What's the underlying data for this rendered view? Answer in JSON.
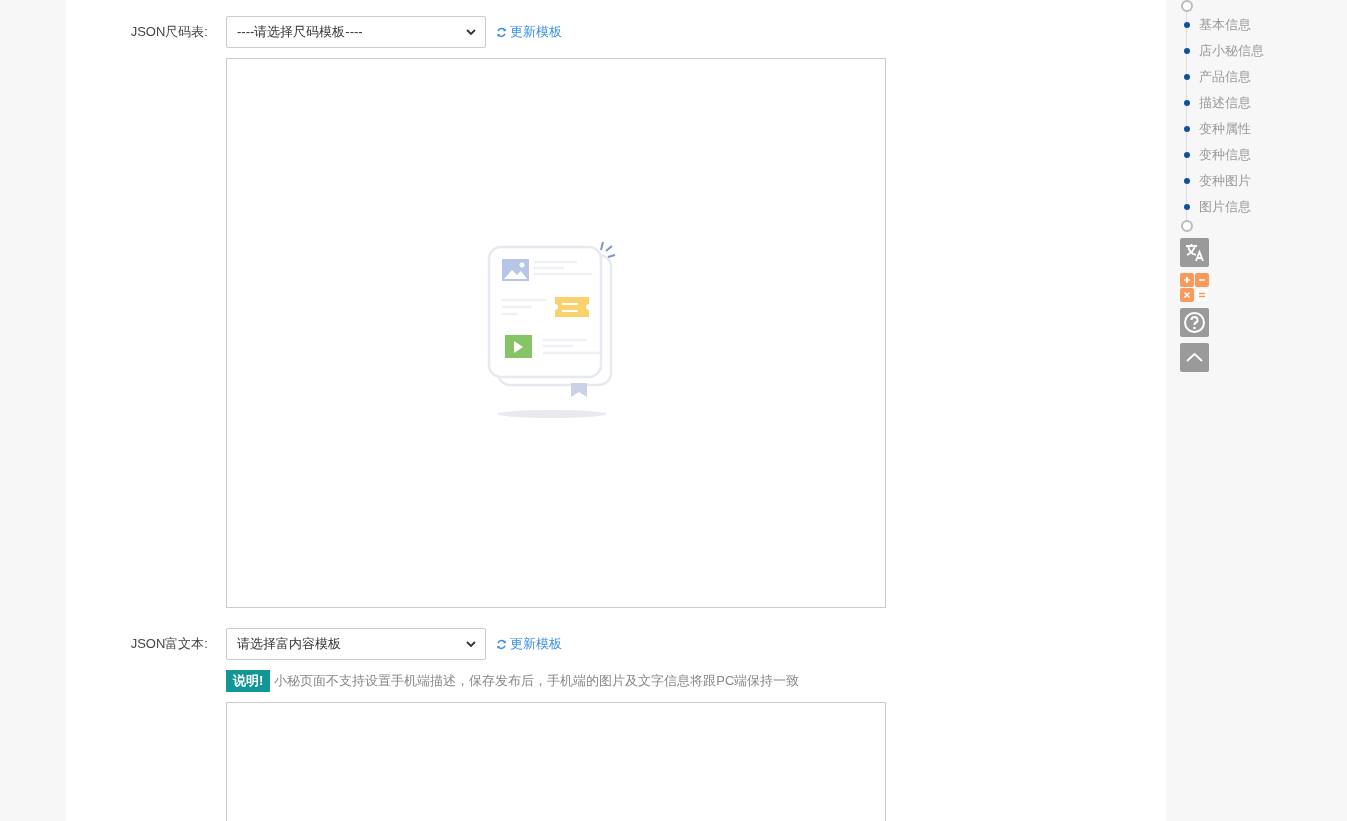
{
  "size_chart": {
    "label": "JSON尺码表:",
    "select_value": "----请选择尺码模板----",
    "refresh_link": "更新模板"
  },
  "rich_text": {
    "label": "JSON富文本:",
    "select_value": "请选择富内容模板",
    "refresh_link": "更新模板",
    "notice_badge": "说明!",
    "notice_text": "小秘页面不支持设置手机端描述，保存发布后，手机端的图片及文字信息将跟PC端保持一致"
  },
  "nav": {
    "items": [
      "基本信息",
      "店小秘信息",
      "产品信息",
      "描述信息",
      "变种属性",
      "变种信息",
      "变种图片",
      "图片信息"
    ]
  }
}
